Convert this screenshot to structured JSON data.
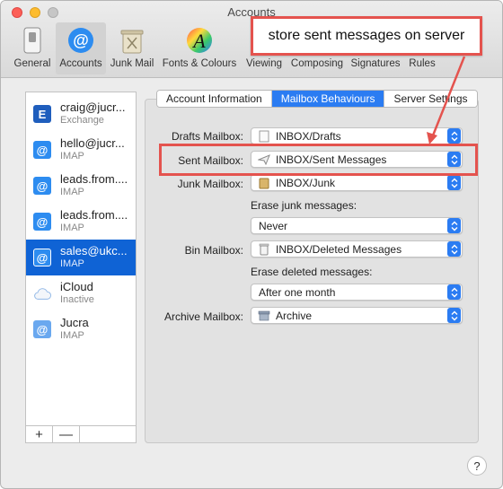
{
  "window": {
    "title": "Accounts"
  },
  "toolbar": {
    "items": [
      {
        "label": "General"
      },
      {
        "label": "Accounts"
      },
      {
        "label": "Junk Mail"
      },
      {
        "label": "Fonts & Colours"
      },
      {
        "label": "Viewing"
      },
      {
        "label": "Composing"
      },
      {
        "label": "Signatures"
      },
      {
        "label": "Rules"
      }
    ]
  },
  "annotation": {
    "text": "store sent messages on server",
    "color": "#e4534e"
  },
  "sidebar": {
    "accounts": [
      {
        "name": "craig@jucr...",
        "type": "Exchange",
        "icon": "exchange-icon"
      },
      {
        "name": "hello@jucr...",
        "type": "IMAP",
        "icon": "at-icon"
      },
      {
        "name": "leads.from....",
        "type": "IMAP",
        "icon": "at-icon"
      },
      {
        "name": "leads.from....",
        "type": "IMAP",
        "icon": "at-icon"
      },
      {
        "name": "sales@ukc...",
        "type": "IMAP",
        "icon": "at-icon"
      },
      {
        "name": "iCloud",
        "type": "Inactive",
        "icon": "cloud-icon"
      },
      {
        "name": "Jucra",
        "type": "IMAP",
        "icon": "at-icon"
      }
    ],
    "add_label": "+",
    "remove_label": "—"
  },
  "tabs": [
    {
      "label": "Account Information"
    },
    {
      "label": "Mailbox Behaviours"
    },
    {
      "label": "Server Settings"
    }
  ],
  "form": {
    "drafts": {
      "label": "Drafts Mailbox:",
      "value": "INBOX/Drafts"
    },
    "sent": {
      "label": "Sent Mailbox:",
      "value": "INBOX/Sent Messages"
    },
    "junk": {
      "label": "Junk Mailbox:",
      "value": "INBOX/Junk"
    },
    "erase_junk": {
      "label": "Erase junk messages:",
      "value": "Never"
    },
    "bin": {
      "label": "Bin Mailbox:",
      "value": "INBOX/Deleted Messages"
    },
    "erase_deleted": {
      "label": "Erase deleted messages:",
      "value": "After one month"
    },
    "archive": {
      "label": "Archive Mailbox:",
      "value": "Archive"
    }
  },
  "help": {
    "label": "?"
  },
  "colors": {
    "accent": "#2b7cf2",
    "selection": "#0f63d5"
  }
}
